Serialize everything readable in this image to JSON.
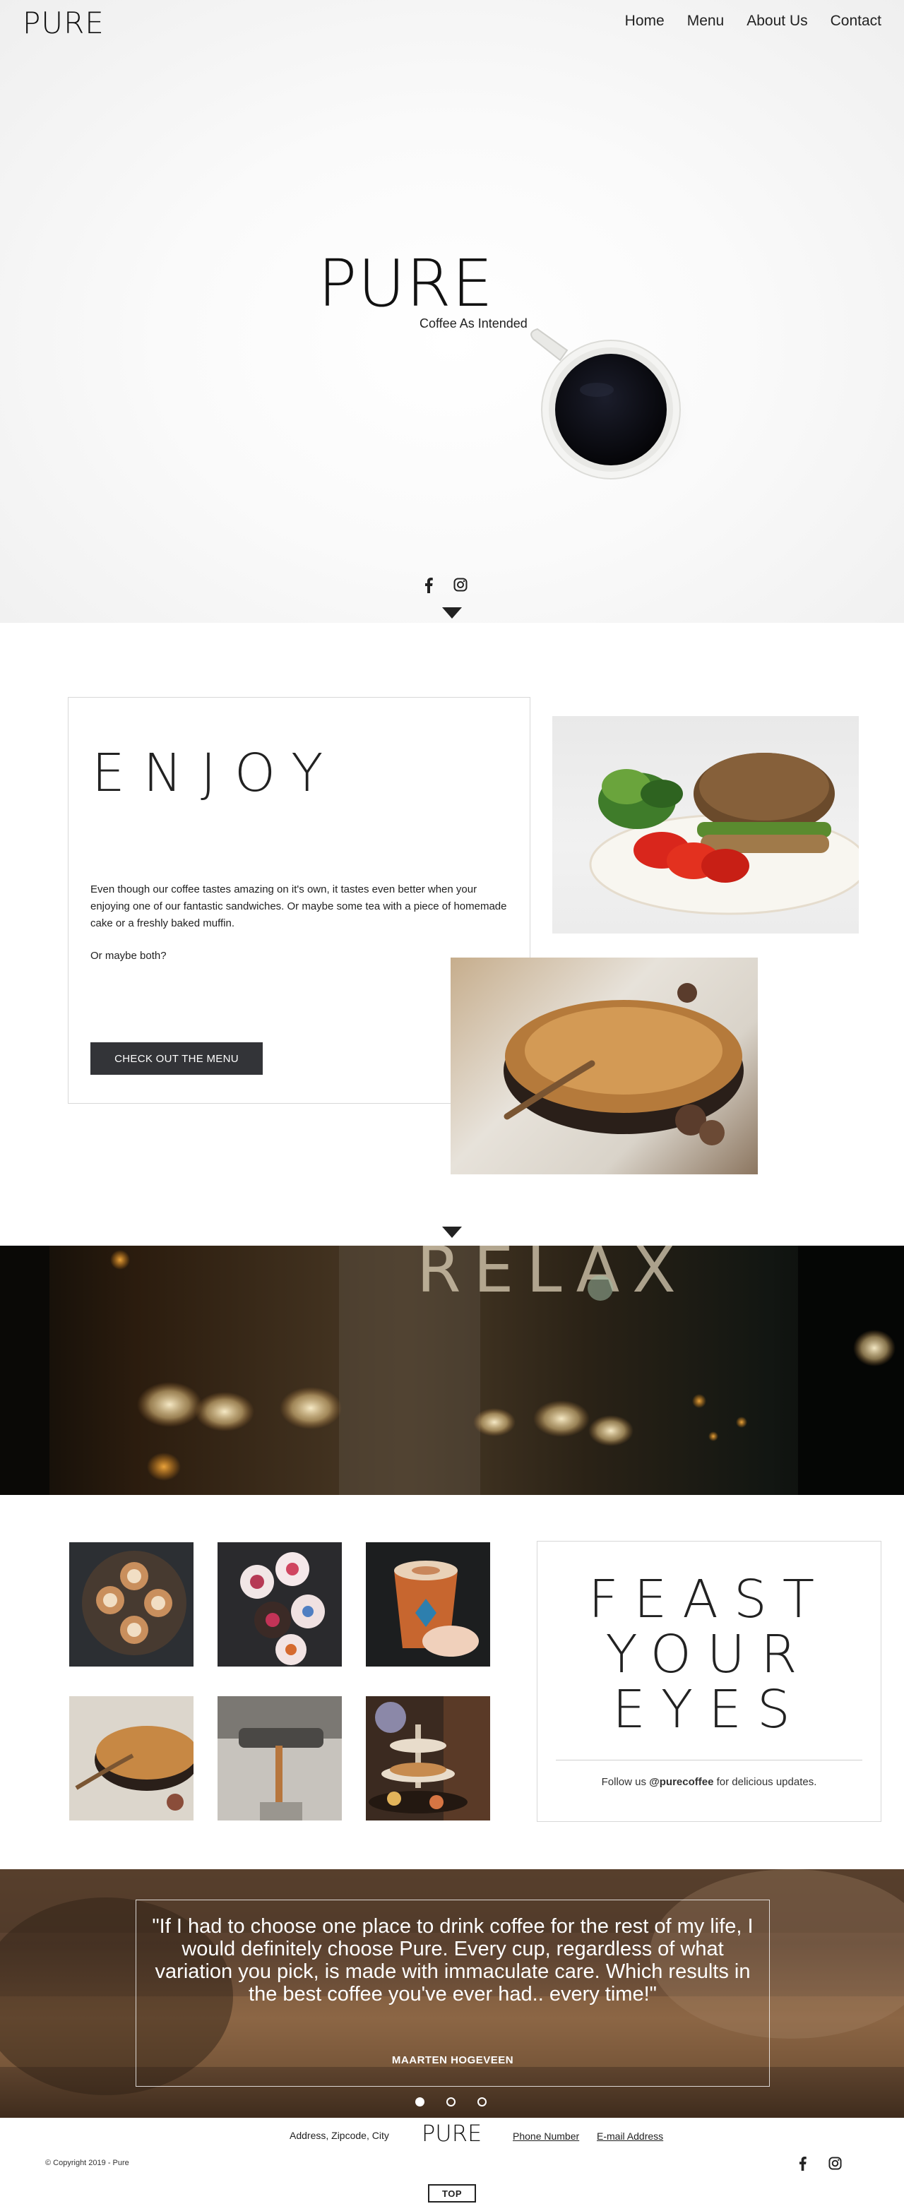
{
  "header": {
    "logo": "PURE",
    "nav": [
      "Home",
      "Menu",
      "About Us",
      "Contact"
    ]
  },
  "hero": {
    "title": "PURE",
    "subtitle": "Coffee As Intended",
    "social_icons": [
      "facebook-icon",
      "instagram-icon"
    ],
    "scroll_icon": "chevron-down-icon"
  },
  "enjoy": {
    "title": "ENJOY",
    "paragraph": "Even though our coffee tastes amazing on it's own, it tastes even better when your enjoying one of our fantastic sandwiches. Or maybe some tea with a piece of homemade cake or a freshly baked muffin.",
    "paragraph2": "Or maybe both?",
    "button": "CHECK OUT THE MENU",
    "scroll_icon": "chevron-down-icon"
  },
  "feast": {
    "title_lines": [
      "FEAST",
      "YOUR",
      "EYES"
    ],
    "follow_prefix": "Follow us ",
    "handle": "@purecoffee",
    "follow_suffix": " for delicious updates."
  },
  "testimonial": {
    "quote": "\"If I had to choose one place to drink coffee for the rest of my life, I would definitely choose Pure. Every cup, regardless of what variation you pick, is made with immaculate care. Which results in the best coffee you've ever had.. every time!\"",
    "author": "MAARTEN HOGEVEEN",
    "dots": 3,
    "active_dot": 0
  },
  "footer": {
    "address": "Address, Zipcode, City",
    "logo": "PURE",
    "phone": "Phone Number",
    "email": "E-mail Address",
    "copyright": "© Copyright 2019 - Pure",
    "social_icons": [
      "facebook-icon",
      "instagram-icon"
    ],
    "top_button": "TOP"
  },
  "colors": {
    "button_dark": "#333438",
    "text": "#222222",
    "border": "#d8d8d8"
  }
}
